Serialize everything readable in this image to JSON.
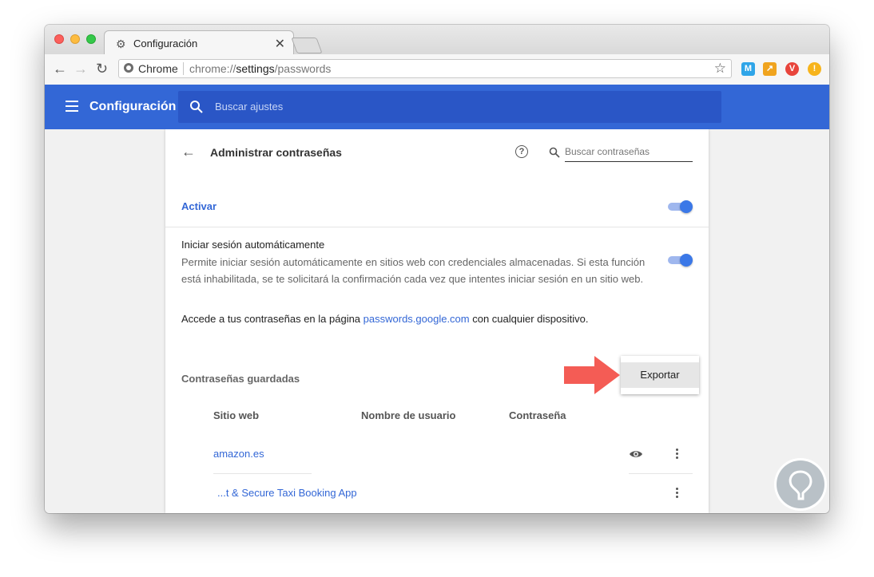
{
  "browser": {
    "tab_title": "Configuración",
    "close_glyph": "✕",
    "omnibox_chip": "Chrome",
    "url_scheme": "chrome://",
    "url_host": "settings",
    "url_path": "/passwords"
  },
  "extensions": [
    {
      "name": "m-extension-icon",
      "glyph": "M",
      "color": "#2fa5e8"
    },
    {
      "name": "chart-extension-icon",
      "glyph": "↗",
      "color": "#f0a41f"
    },
    {
      "name": "vivaldi-extension-icon",
      "glyph": "V",
      "color": "#e8453c"
    },
    {
      "name": "alert-extension-icon",
      "glyph": "!",
      "color": "#f7b41c"
    }
  ],
  "header": {
    "title": "Configuración",
    "search_placeholder": "Buscar ajustes"
  },
  "passwords": {
    "page_title": "Administrar contraseñas",
    "help_glyph": "?",
    "search_placeholder": "Buscar contraseñas",
    "activar_label": "Activar",
    "autosignin_title": "Iniciar sesión automáticamente",
    "autosignin_desc": "Permite iniciar sesión automáticamente en sitios web con credenciales almacenadas. Si esta función está inhabilitada, se te solicitará la confirmación cada vez que intentes iniciar sesión en un sitio web.",
    "access_prefix": "Accede a tus contraseñas en la página ",
    "access_link": "passwords.google.com",
    "access_suffix": " con cualquier dispositivo.",
    "saved_heading": "Contraseñas guardadas",
    "export_label": "Exportar",
    "columns": [
      "Sitio web",
      "Nombre de usuario",
      "Contraseña"
    ],
    "rows": [
      {
        "site": "amazon.es"
      },
      {
        "site": "...t & Secure Taxi Booking App"
      }
    ]
  },
  "colors": {
    "brand_blue": "#3367d6",
    "arrow_red": "#f45c55"
  }
}
